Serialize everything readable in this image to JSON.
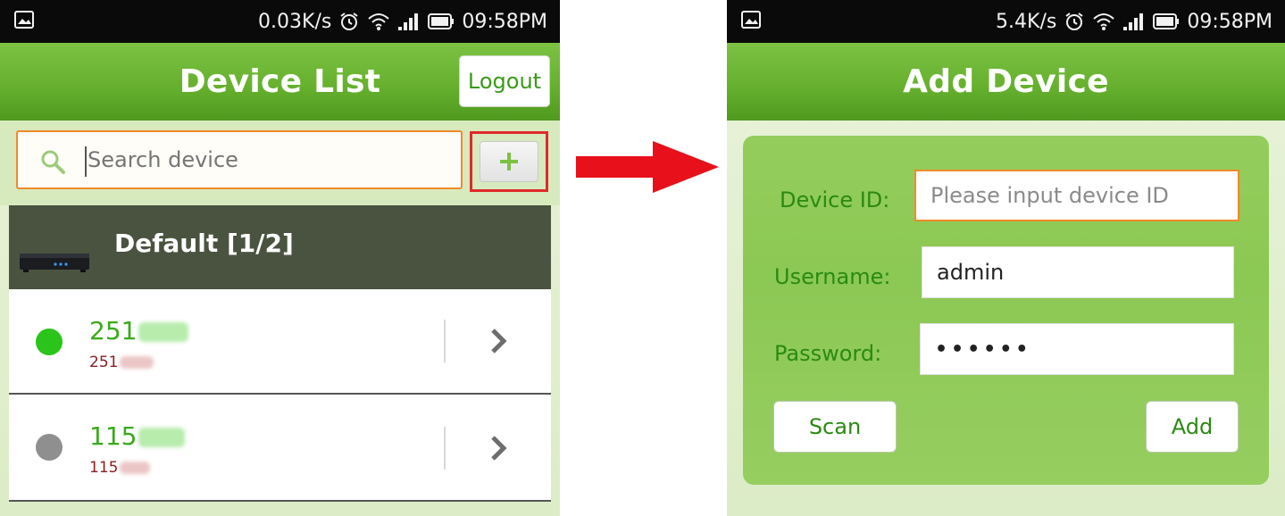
{
  "left_screen": {
    "status": {
      "speed": "0.03K/s",
      "time": "09:58PM"
    },
    "title": "Device List",
    "logout_label": "Logout",
    "search": {
      "placeholder": "Search device"
    },
    "add_button_label": "+",
    "group": {
      "label": "Default [1/2]"
    },
    "devices": [
      {
        "name": "251",
        "sub": "251",
        "status": "online",
        "status_color": "#2bc41a"
      },
      {
        "name": "115",
        "sub": "115",
        "status": "offline",
        "status_color": "#8f8f8f"
      }
    ]
  },
  "right_screen": {
    "status": {
      "speed": "5.4K/s",
      "time": "09:58PM"
    },
    "title": "Add Device",
    "form": {
      "device_id": {
        "label": "Device ID:",
        "value": "",
        "placeholder": "Please input device ID"
      },
      "username": {
        "label": "Username:",
        "value": "admin"
      },
      "password": {
        "label": "Password:",
        "value": "••••••"
      }
    },
    "scan_label": "Scan",
    "add_label": "Add"
  },
  "colors": {
    "accent_green": "#67b12f",
    "highlight_orange": "#f08a2a",
    "highlight_red": "#e02a2a",
    "group_header": "#4a5340"
  },
  "icons": [
    "image-icon",
    "alarm-icon",
    "wifi-icon",
    "signal-icon",
    "battery-icon",
    "search-icon",
    "plus-icon",
    "dvr-icon",
    "chevron-right-icon",
    "arrow-right-icon"
  ]
}
